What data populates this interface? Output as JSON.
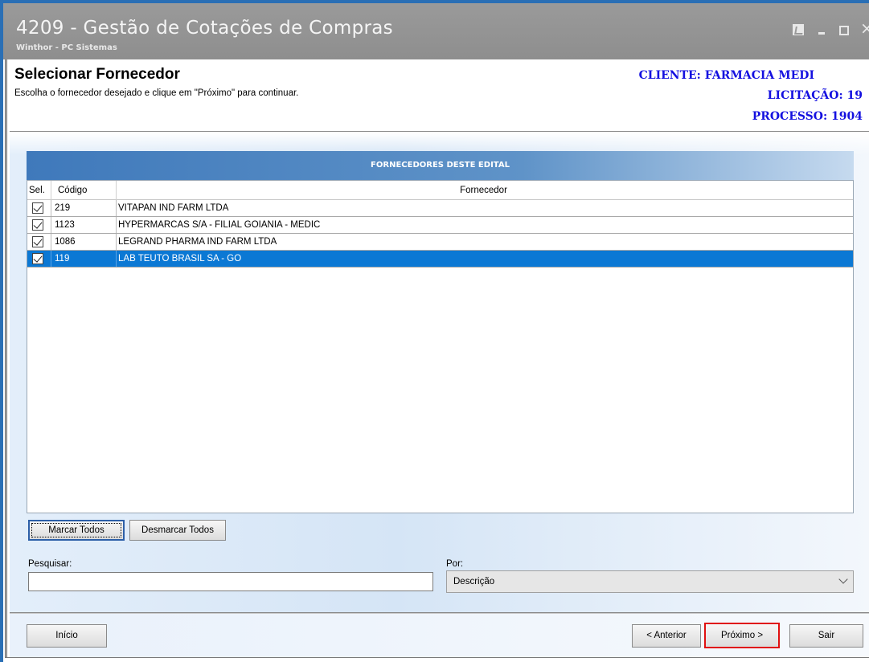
{
  "window": {
    "title": "4209 - Gestão de Cotações de Compras",
    "subtitle": "Winthor - PC Sistemas"
  },
  "header": {
    "title": "Selecionar Fornecedor",
    "description": "Escolha o fornecedor desejado e clique em \"Próximo\" para continuar.",
    "cliente": "CLIENTE: FARMACIA MEDI",
    "licitacao": "LICITAÇÃO: 19",
    "processo": "PROCESSO: 1904"
  },
  "grid": {
    "title": "FORNECEDORES DESTE EDITAL",
    "columns": {
      "sel": "Sel.",
      "codigo": "Código",
      "fornecedor": "Fornecedor"
    },
    "rows": [
      {
        "checked": true,
        "codigo": "219",
        "fornecedor": "VITAPAN IND FARM LTDA"
      },
      {
        "checked": true,
        "codigo": "1123",
        "fornecedor": "HYPERMARCAS S/A - FILIAL GOIANIA - MEDIC"
      },
      {
        "checked": true,
        "codigo": "1086",
        "fornecedor": "LEGRAND PHARMA IND FARM LTDA"
      },
      {
        "checked": true,
        "codigo": "119",
        "fornecedor": "LAB TEUTO BRASIL SA - GO",
        "selected": true
      }
    ]
  },
  "actions": {
    "marcar_todos": "Marcar Todos",
    "desmarcar_todos": "Desmarcar Todos"
  },
  "search": {
    "label": "Pesquisar:",
    "value": "",
    "por_label": "Por:",
    "por_value": "Descrição"
  },
  "footer": {
    "inicio": "Início",
    "anterior": "< Anterior",
    "proximo": "Próximo >",
    "sair": "Sair"
  },
  "colors": {
    "titlebar": "#8e8e8e",
    "info_text": "#1410e0",
    "selected_row": "#0b78d4",
    "grid_header": "#3f79bb",
    "highlight_border": "#e01010"
  }
}
